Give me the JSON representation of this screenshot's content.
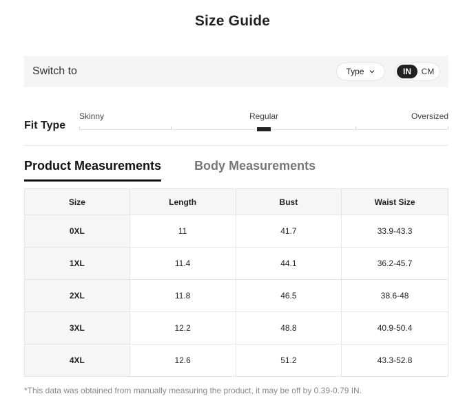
{
  "title": "Size Guide",
  "switch_bar": {
    "label": "Switch to",
    "type_select": {
      "label": "Type",
      "icon": "chevron-down-icon"
    },
    "units": [
      {
        "label": "IN",
        "active": true
      },
      {
        "label": "CM",
        "active": false
      }
    ]
  },
  "fit_type": {
    "label": "Fit Type",
    "options": [
      "Skinny",
      "Regular",
      "Oversized"
    ],
    "selected": "Regular"
  },
  "tabs": [
    {
      "label": "Product Measurements",
      "active": true
    },
    {
      "label": "Body Measurements",
      "active": false
    }
  ],
  "table": {
    "headers": [
      "Size",
      "Length",
      "Bust",
      "Waist Size"
    ],
    "rows": [
      [
        "0XL",
        "11",
        "41.7",
        "33.9-43.3"
      ],
      [
        "1XL",
        "11.4",
        "44.1",
        "36.2-45.7"
      ],
      [
        "2XL",
        "11.8",
        "46.5",
        "38.6-48"
      ],
      [
        "3XL",
        "12.2",
        "48.8",
        "40.9-50.4"
      ],
      [
        "4XL",
        "12.6",
        "51.2",
        "43.3-52.8"
      ]
    ]
  },
  "footnote": "*This data was obtained from manually measuring the product, it may be off by 0.39-0.79 IN.",
  "colors": {
    "accent": "#222222",
    "panel_bg": "#f5f5f5",
    "muted_text": "#888888"
  }
}
